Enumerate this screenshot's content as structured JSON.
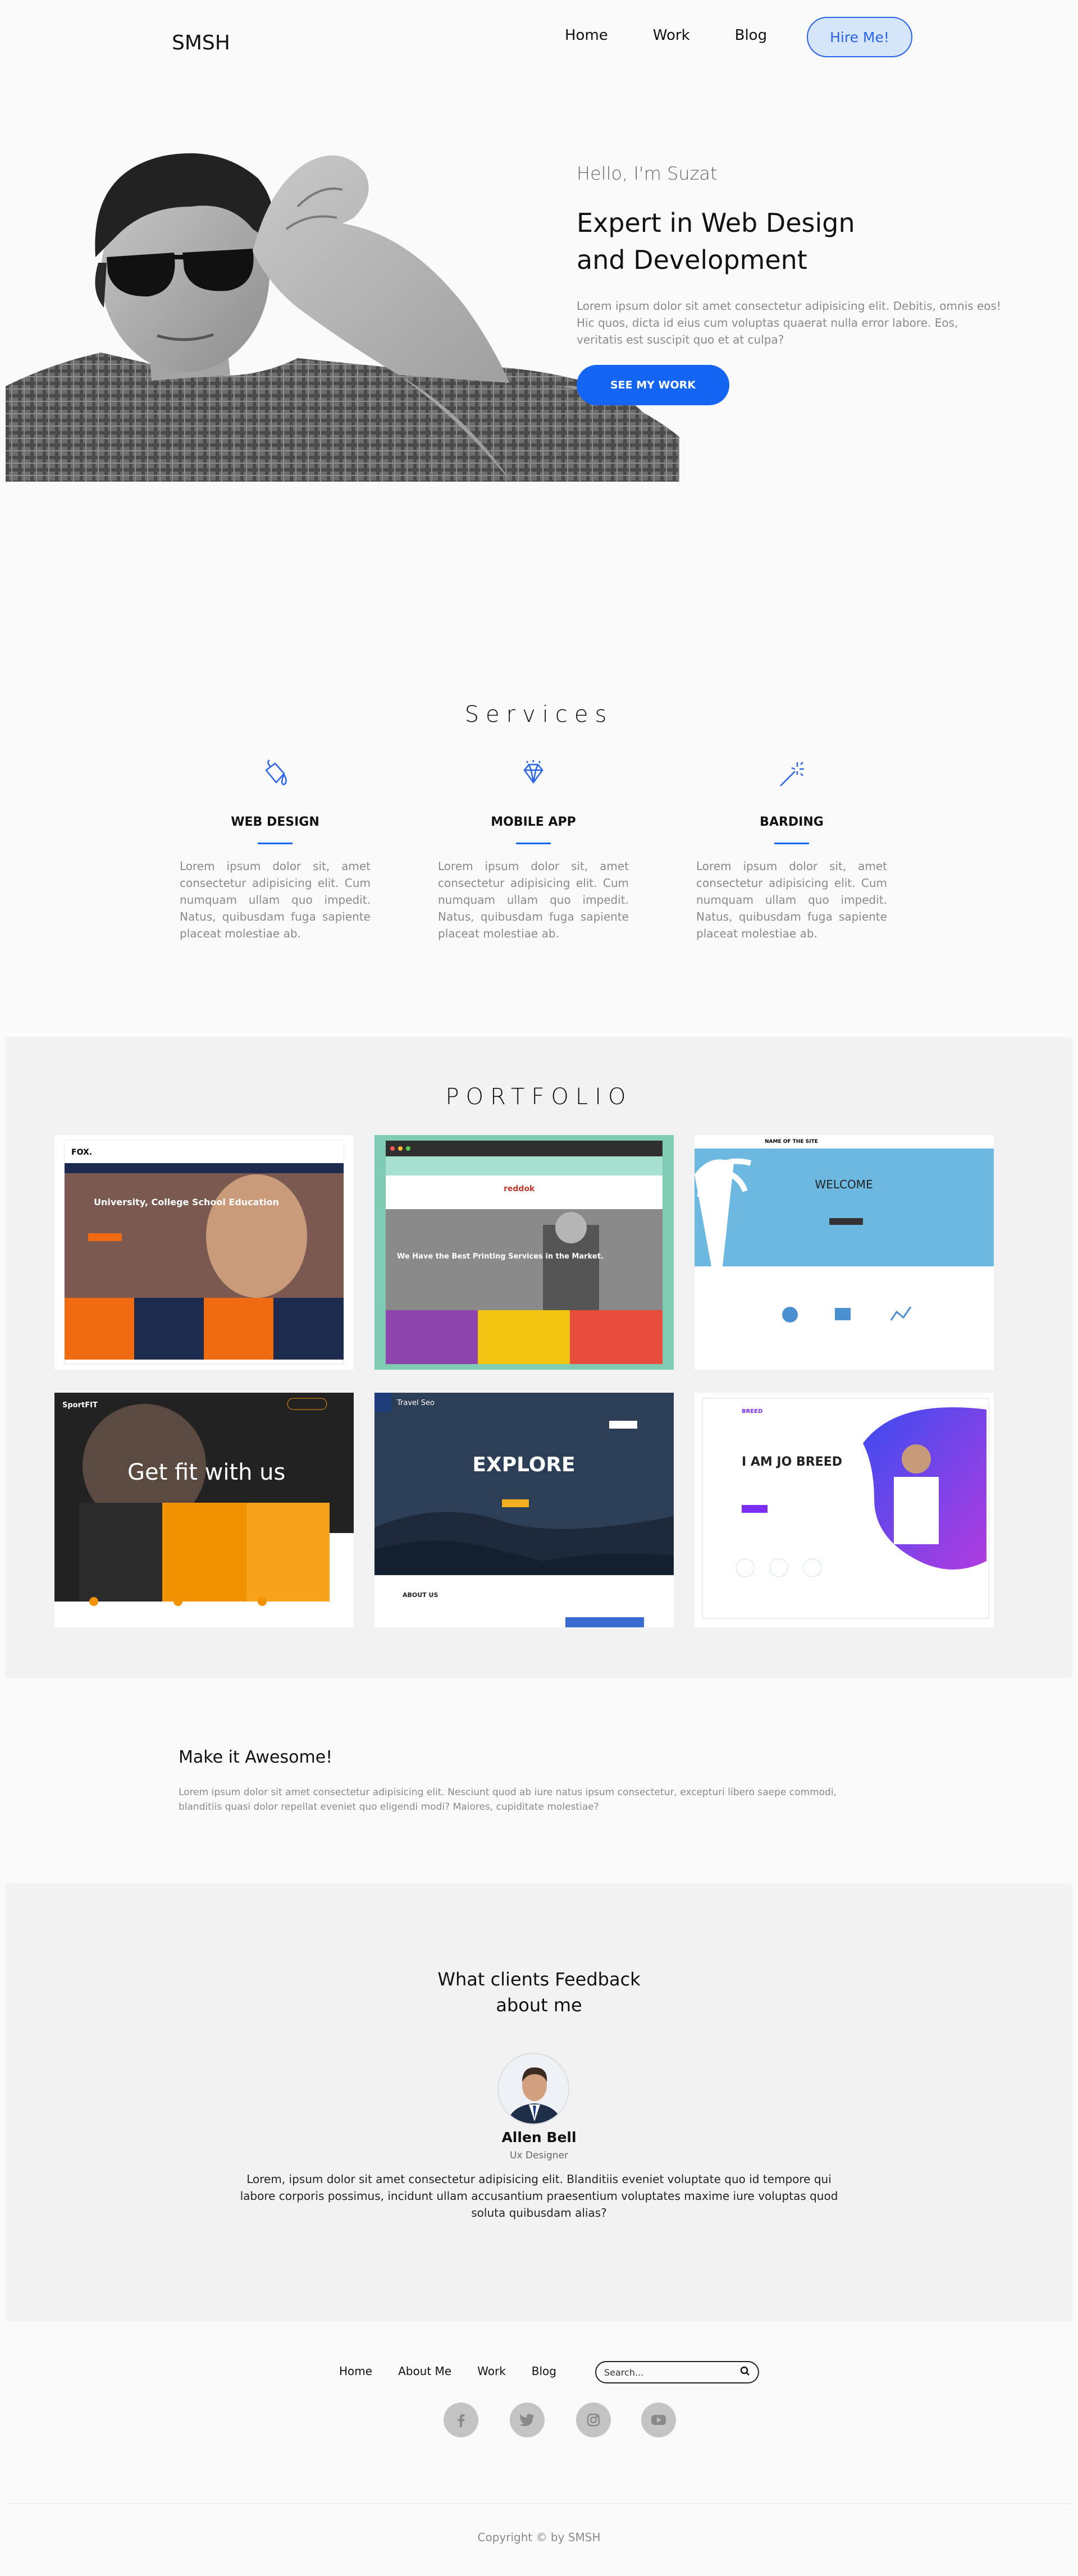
{
  "header": {
    "logo": "SMSH",
    "nav": [
      "Home",
      "Work",
      "Blog"
    ],
    "hire_label": "Hire Me!"
  },
  "hero": {
    "greeting": "Hello, I'm Suzat",
    "title_line1": "Expert in Web Design",
    "title_line2": "and Development",
    "description": "Lorem ipsum dolor sit amet consectetur adipisicing elit. Debitis, omnis eos! Hic quos, dicta id eius cum voluptas quaerat nulla error labore. Eos, veritatis est suscipit quo et at culpa?",
    "cta_label": "SEE MY WORK"
  },
  "services": {
    "title": "Services",
    "items": [
      {
        "icon": "paint-bucket-icon",
        "title": "WEB DESIGN",
        "text": "Lorem ipsum dolor sit, amet consectetur adipisicing elit. Cum numquam ullam quo impedit. Natus, quibusdam fuga sapiente placeat molestiae ab."
      },
      {
        "icon": "diamond-icon",
        "title": "MOBILE APP",
        "text": "Lorem ipsum dolor sit, amet consectetur adipisicing elit. Cum numquam ullam quo impedit. Natus, quibusdam fuga sapiente placeat molestiae ab."
      },
      {
        "icon": "magic-wand-icon",
        "title": "BARDING",
        "text": "Lorem ipsum dolor sit, amet consectetur adipisicing elit. Cum numquam ullam quo impedit. Natus, quibusdam fuga sapiente placeat molestiae ab."
      }
    ],
    "accent": "#1565f5"
  },
  "portfolio": {
    "title": "PORTFOLIO",
    "cards": [
      {
        "heading": "University, College School Education",
        "brand": "FOX."
      },
      {
        "heading": "We Have the Best Printing Services in the Market.",
        "brand": "reddok"
      },
      {
        "heading": "WELCOME",
        "brand": "NAME OF THE SITE"
      },
      {
        "heading": "Get fit with us",
        "brand": "SportFIT"
      },
      {
        "heading": "EXPLORE",
        "brand": "Travel Seo",
        "sub": "ABOUT US"
      },
      {
        "heading": "I AM JO BREED",
        "brand": "BREED"
      }
    ]
  },
  "awesome": {
    "title": "Make it Awesome!",
    "description": "Lorem ipsum dolor sit amet consectetur adipisicing elit. Nesciunt quod ab iure natus ipsum consectetur, excepturi libero saepe commodi, blanditiis quasi dolor repellat eveniet quo eligendi modi? Maiores, cupiditate molestiae?"
  },
  "feedback": {
    "title_line1": "What clients Feedback",
    "title_line2": "about me",
    "name": "Allen Bell",
    "role": "Ux Designer",
    "quote": "Lorem, ipsum dolor sit amet consectetur adipisicing elit. Blanditiis eveniet voluptate quo id tempore qui labore corporis possimus, incidunt ullam accusantium praesentium voluptates maxime iure voluptas quod soluta quibusdam alias?"
  },
  "footer": {
    "nav": [
      "Home",
      "About Me",
      "Work",
      "Blog"
    ],
    "search_placeholder": "Search...",
    "social": [
      "facebook-icon",
      "twitter-icon",
      "instagram-icon",
      "youtube-icon"
    ],
    "copyright": "Copyright © by SMSH"
  }
}
